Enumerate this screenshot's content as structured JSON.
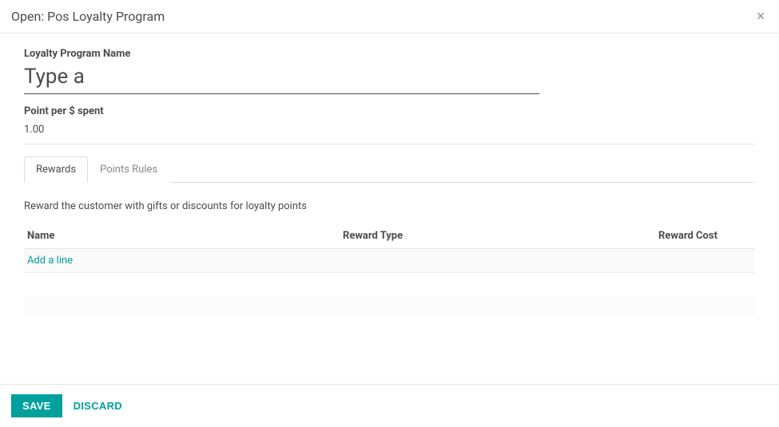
{
  "header": {
    "title": "Open: Pos Loyalty Program"
  },
  "fields": {
    "name_label": "Loyalty Program Name",
    "name_value": "Type a",
    "points_label": "Point per $ spent",
    "points_value": "1.00"
  },
  "tabs": {
    "rewards": "Rewards",
    "points_rules": "Points Rules"
  },
  "rewards": {
    "description": "Reward the customer with gifts or discounts for loyalty points",
    "columns": {
      "name": "Name",
      "type": "Reward Type",
      "cost": "Reward Cost"
    },
    "add_line": "Add a line"
  },
  "footer": {
    "save": "SAVE",
    "discard": "DISCARD"
  }
}
